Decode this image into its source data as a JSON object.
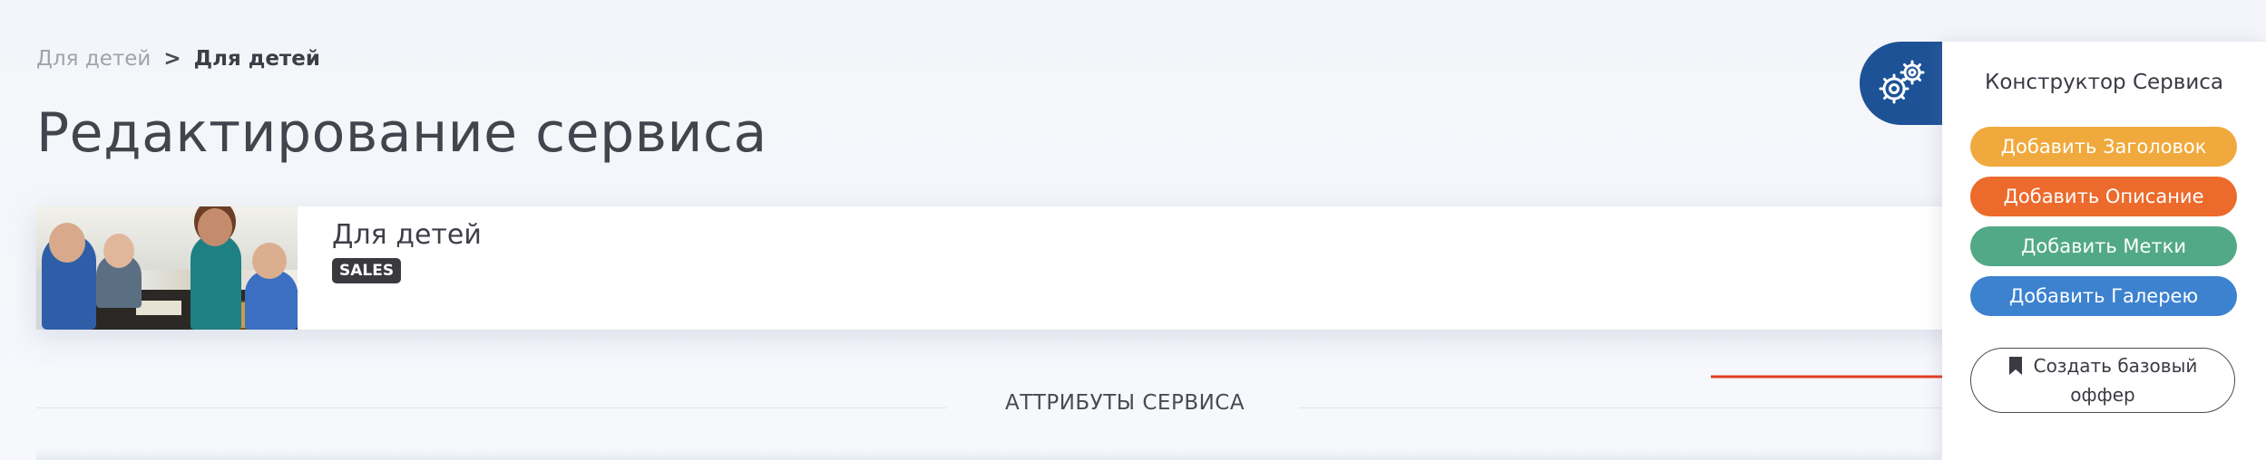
{
  "breadcrumb": {
    "parent": "Для детей",
    "separator": ">",
    "current": "Для детей"
  },
  "page_title": "Редактирование сервиса",
  "service": {
    "name": "Для детей",
    "badge": "SALES"
  },
  "section": {
    "label": "АТТРИБУТЫ СЕРВИСА"
  },
  "constructor": {
    "title": "Конструктор Сервиса",
    "buttons": {
      "add_header": "Добавить Заголовок",
      "add_description": "Добавить Описание",
      "add_tags": "Добавить Метки",
      "add_gallery": "Добавить Галерею",
      "create_offer_line1": "Создать базовый",
      "create_offer_line2": "оффер"
    }
  },
  "colors": {
    "gear_tab": "#1e5296",
    "btn_header": "#f0a93c",
    "btn_description": "#ec6a2c",
    "btn_tags": "#52a988",
    "btn_gallery": "#3d82cf",
    "arrow": "#e23b22"
  },
  "icons": {
    "gear_tab": "gears-icon",
    "offer": "bookmark-icon",
    "annotation": "red-arrow-icon"
  }
}
